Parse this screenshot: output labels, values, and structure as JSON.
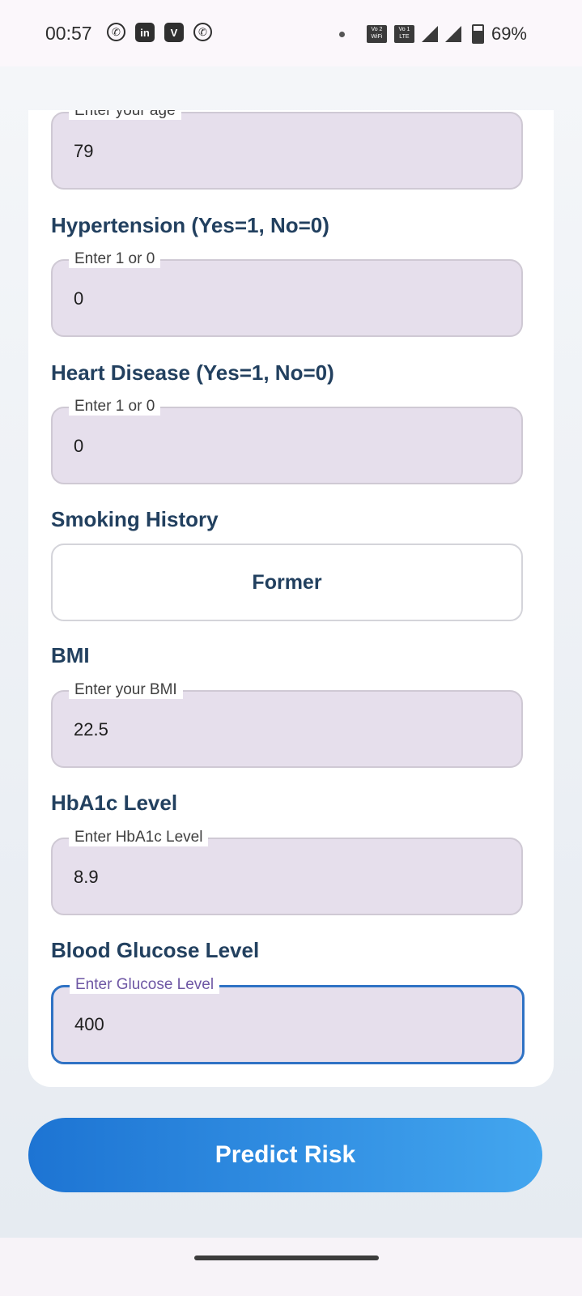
{
  "status_bar": {
    "time": "00:57",
    "notifications": [
      "whatsapp-icon",
      "linkedin-icon",
      "vimeo-icon",
      "viber-icon"
    ],
    "vowifi": "Vo 2 WiFi",
    "volte": "Vo 1 LTE",
    "battery": "69%"
  },
  "form": {
    "age": {
      "placeholder": "Enter your age",
      "value": "79"
    },
    "hypertension": {
      "label": "Hypertension (Yes=1, No=0)",
      "placeholder": "Enter 1 or 0",
      "value": "0"
    },
    "heart_disease": {
      "label": "Heart Disease (Yes=1, No=0)",
      "placeholder": "Enter 1 or 0",
      "value": "0"
    },
    "smoking": {
      "label": "Smoking History",
      "selected": "Former"
    },
    "bmi": {
      "label": "BMI",
      "placeholder": "Enter your BMI",
      "value": "22.5"
    },
    "hba1c": {
      "label": "HbA1c Level",
      "placeholder": "Enter HbA1c Level",
      "value": "8.9"
    },
    "glucose": {
      "label": "Blood Glucose Level",
      "placeholder": "Enter Glucose Level",
      "value": "400"
    }
  },
  "actions": {
    "predict_label": "Predict Risk"
  },
  "colors": {
    "accent": "#2f72c4",
    "heading": "#22405f",
    "field_bg": "#e6dfec",
    "button_gradient_start": "#1d74d3",
    "button_gradient_end": "#43a6ef"
  }
}
